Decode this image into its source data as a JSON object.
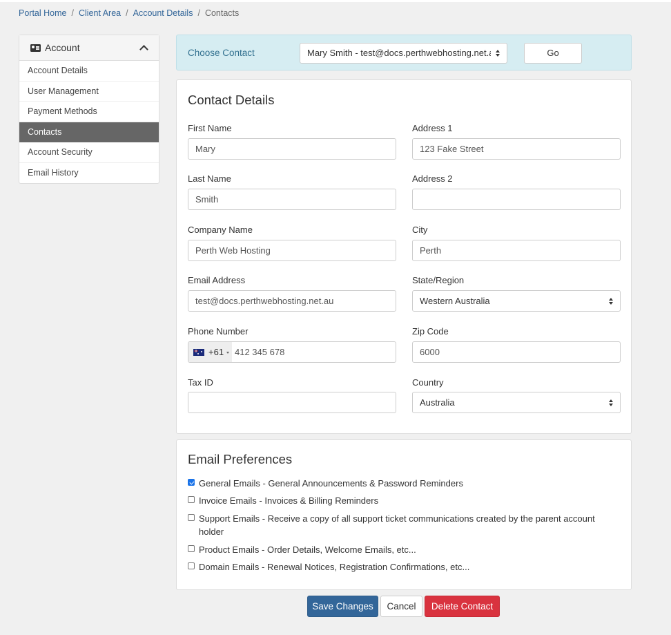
{
  "breadcrumb": {
    "items": [
      "Portal Home",
      "Client Area",
      "Account Details",
      "Contacts"
    ],
    "separator": "/"
  },
  "sidebar": {
    "title": "Account",
    "items": [
      {
        "label": "Account Details",
        "active": false
      },
      {
        "label": "User Management",
        "active": false
      },
      {
        "label": "Payment Methods",
        "active": false
      },
      {
        "label": "Contacts",
        "active": true
      },
      {
        "label": "Account Security",
        "active": false
      },
      {
        "label": "Email History",
        "active": false
      }
    ]
  },
  "choose_contact": {
    "label": "Choose Contact",
    "selected": "Mary Smith - test@docs.perthwebhosting.net.au",
    "go_label": "Go"
  },
  "contact_details": {
    "title": "Contact Details",
    "first_name": {
      "label": "First Name",
      "value": "Mary"
    },
    "last_name": {
      "label": "Last Name",
      "value": "Smith"
    },
    "company": {
      "label": "Company Name",
      "value": "Perth Web Hosting"
    },
    "email": {
      "label": "Email Address",
      "value": "test@docs.perthwebhosting.net.au"
    },
    "phone": {
      "label": "Phone Number",
      "dial_code": "+61",
      "value": "412 345 678",
      "flag": "australia-flag"
    },
    "tax_id": {
      "label": "Tax ID",
      "value": ""
    },
    "address1": {
      "label": "Address 1",
      "value": "123 Fake Street"
    },
    "address2": {
      "label": "Address 2",
      "value": ""
    },
    "city": {
      "label": "City",
      "value": "Perth"
    },
    "state": {
      "label": "State/Region",
      "value": "Western Australia"
    },
    "zip": {
      "label": "Zip Code",
      "value": "6000"
    },
    "country": {
      "label": "Country",
      "value": "Australia"
    }
  },
  "email_preferences": {
    "title": "Email Preferences",
    "items": [
      {
        "label": "General Emails - General Announcements & Password Reminders",
        "checked": true
      },
      {
        "label": "Invoice Emails - Invoices & Billing Reminders",
        "checked": false
      },
      {
        "label": "Support Emails - Receive a copy of all support ticket communications created by the parent account holder",
        "checked": false
      },
      {
        "label": "Product Emails - Order Details, Welcome Emails, etc...",
        "checked": false
      },
      {
        "label": "Domain Emails - Renewal Notices, Registration Confirmations, etc...",
        "checked": false
      }
    ]
  },
  "actions": {
    "save": "Save Changes",
    "cancel": "Cancel",
    "delete": "Delete Contact"
  },
  "colors": {
    "primary": "#336699",
    "danger": "#d9333f",
    "info_bg": "#d6edf2",
    "active_nav": "#666666"
  }
}
